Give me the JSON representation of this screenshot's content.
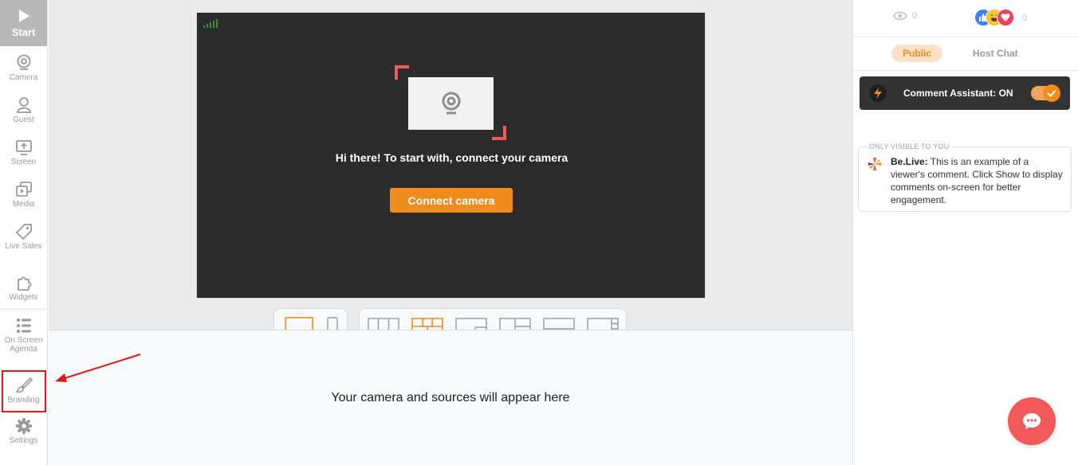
{
  "sidebar": {
    "start": {
      "label": "Start",
      "icon": "play-icon"
    },
    "items": [
      {
        "label": "Camera",
        "icon": "webcam-icon"
      },
      {
        "label": "Guest",
        "icon": "user-icon"
      },
      {
        "label": "Screen",
        "icon": "screen-share-icon"
      },
      {
        "label": "Media",
        "icon": "media-icon"
      },
      {
        "label": "Live Sales",
        "icon": "tag-icon"
      },
      {
        "label": "Widgets",
        "icon": "puzzle-icon"
      },
      {
        "label": "On Screen Agenda",
        "icon": "agenda-icon"
      },
      {
        "label": "Branding",
        "icon": "brush-icon"
      },
      {
        "label": "Settings",
        "icon": "gear-icon"
      }
    ]
  },
  "preview": {
    "message": "Hi there! To start with, connect your camera",
    "connect_label": "Connect camera"
  },
  "bottom": {
    "message": "Your camera and sources will appear here"
  },
  "stats": {
    "views": "0",
    "reactions": "0"
  },
  "chat": {
    "tabs": {
      "public": "Public",
      "host": "Host Chat"
    },
    "assistant_label": "Comment Assistant: ON",
    "only_visible": "ONLY VISIBLE TO YOU",
    "comment_author": "Be.Live:",
    "comment_text": " This is an example of a viewer's comment. Click Show to display comments on-screen for better engagement."
  },
  "colors": {
    "accent": "#f08c1e",
    "highlight": "#e01919",
    "fab": "#f25a5a"
  }
}
